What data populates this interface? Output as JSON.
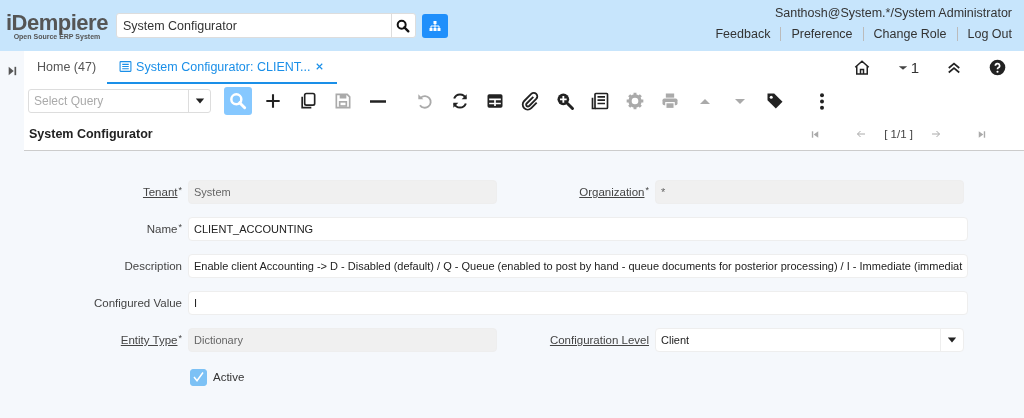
{
  "header": {
    "logo": "iDempiere",
    "logo_tagline": "Open Source ERP System",
    "search": {
      "value": "System Configurator"
    },
    "user": "Santhosh@System.*/System Administrator",
    "links": [
      "Feedback",
      "Preference",
      "Change Role",
      "Log Out"
    ]
  },
  "tabs": [
    {
      "label": "Home (47)",
      "selected": false,
      "closable": false
    },
    {
      "label": "System Configurator: CLIENT...",
      "selected": true,
      "closable": true
    }
  ],
  "tab_tools": {
    "window_count": "1"
  },
  "toolbar": {
    "query": {
      "placeholder": "Select Query"
    },
    "buttons": [
      {
        "kind": "search",
        "selected": true,
        "disabled": false
      },
      {
        "kind": "new",
        "selected": false,
        "disabled": false
      },
      {
        "kind": "copy",
        "selected": false,
        "disabled": false
      },
      {
        "kind": "save",
        "selected": false,
        "disabled": true
      },
      {
        "kind": "delete",
        "selected": false,
        "disabled": false
      },
      {
        "kind": "undo",
        "selected": false,
        "disabled": true
      },
      {
        "kind": "refresh",
        "selected": false,
        "disabled": false
      },
      {
        "kind": "grid",
        "selected": false,
        "disabled": false
      },
      {
        "kind": "attach",
        "selected": false,
        "disabled": false
      },
      {
        "kind": "zoom",
        "selected": false,
        "disabled": false
      },
      {
        "kind": "report",
        "selected": false,
        "disabled": false
      },
      {
        "kind": "gear",
        "selected": false,
        "disabled": true
      },
      {
        "kind": "print",
        "selected": false,
        "disabled": true
      },
      {
        "kind": "up",
        "selected": false,
        "disabled": true
      },
      {
        "kind": "down",
        "selected": false,
        "disabled": true
      },
      {
        "kind": "tag",
        "selected": false,
        "disabled": false
      },
      {
        "kind": "more",
        "selected": false,
        "disabled": false
      }
    ]
  },
  "panel": {
    "title": "System Configurator",
    "record": "[ 1/1 ]"
  },
  "form": {
    "rows": [
      [
        {
          "kind": "text",
          "label": "Tenant",
          "link": true,
          "required_mark": "*",
          "value": "System",
          "readonly": true
        },
        {
          "kind": "text",
          "label": "Organization",
          "link": true,
          "required_mark": "*",
          "value": "*",
          "readonly": true
        }
      ],
      [
        {
          "kind": "text",
          "label": "Name",
          "link": false,
          "required_mark": "*",
          "value": "CLIENT_ACCOUNTING",
          "readonly": false
        }
      ],
      [
        {
          "kind": "text",
          "label": "Description",
          "link": false,
          "value": "Enable client Accounting -> D - Disabled (default) / Q - Queue (enabled to post by hand - queue documents for posterior processing) / I - Immediate (immediat",
          "readonly": false
        }
      ],
      [
        {
          "kind": "text",
          "label": "Configured Value",
          "link": false,
          "value": "I",
          "readonly": false
        }
      ],
      [
        {
          "kind": "text",
          "label": "Entity Type",
          "link": true,
          "required_mark": "*",
          "value": "Dictionary",
          "readonly": true
        },
        {
          "kind": "select",
          "label": "Configuration Level",
          "link": true,
          "value": "Client",
          "readonly": false
        }
      ],
      [
        {
          "kind": "checkbox",
          "label": "Active",
          "checked": true
        }
      ]
    ]
  }
}
